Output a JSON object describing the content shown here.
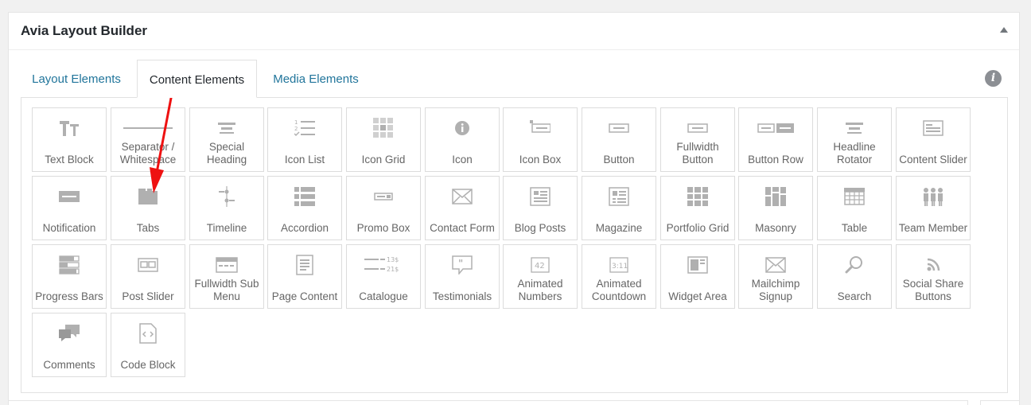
{
  "panel": {
    "title": "Avia Layout Builder"
  },
  "tabs": [
    {
      "label": "Layout Elements",
      "active": false
    },
    {
      "label": "Content Elements",
      "active": true
    },
    {
      "label": "Media Elements",
      "active": false
    }
  ],
  "elements": [
    {
      "label": "Text Block",
      "icon": "text-block-icon"
    },
    {
      "label": "Separator / Whitespace",
      "icon": "separator-icon"
    },
    {
      "label": "Special Heading",
      "icon": "special-heading-icon"
    },
    {
      "label": "Icon List",
      "icon": "icon-list-icon"
    },
    {
      "label": "Icon Grid",
      "icon": "icon-grid-icon"
    },
    {
      "label": "Icon",
      "icon": "info-circle-icon"
    },
    {
      "label": "Icon Box",
      "icon": "icon-box-icon"
    },
    {
      "label": "Button",
      "icon": "button-icon"
    },
    {
      "label": "Fullwidth Button",
      "icon": "fullwidth-button-icon"
    },
    {
      "label": "Button Row",
      "icon": "button-row-icon"
    },
    {
      "label": "Headline Rotator",
      "icon": "headline-rotator-icon"
    },
    {
      "label": "Content Slider",
      "icon": "content-slider-icon"
    },
    {
      "label": "Notification",
      "icon": "notification-icon"
    },
    {
      "label": "Tabs",
      "icon": "tabs-icon"
    },
    {
      "label": "Timeline",
      "icon": "timeline-icon"
    },
    {
      "label": "Accordion",
      "icon": "accordion-icon"
    },
    {
      "label": "Promo Box",
      "icon": "promo-box-icon"
    },
    {
      "label": "Contact Form",
      "icon": "envelope-icon"
    },
    {
      "label": "Blog Posts",
      "icon": "blog-posts-icon"
    },
    {
      "label": "Magazine",
      "icon": "magazine-icon"
    },
    {
      "label": "Portfolio Grid",
      "icon": "portfolio-grid-icon"
    },
    {
      "label": "Masonry",
      "icon": "masonry-icon"
    },
    {
      "label": "Table",
      "icon": "table-icon"
    },
    {
      "label": "Team Member",
      "icon": "team-member-icon"
    },
    {
      "label": "Progress Bars",
      "icon": "progress-bars-icon"
    },
    {
      "label": "Post Slider",
      "icon": "post-slider-icon"
    },
    {
      "label": "Fullwidth Sub Menu",
      "icon": "sub-menu-icon"
    },
    {
      "label": "Page Content",
      "icon": "page-content-icon"
    },
    {
      "label": "Catalogue",
      "icon": "catalogue-icon"
    },
    {
      "label": "Testimonials",
      "icon": "testimonials-icon"
    },
    {
      "label": "Animated Numbers",
      "icon": "animated-numbers-icon"
    },
    {
      "label": "Animated Countdown",
      "icon": "animated-countdown-icon"
    },
    {
      "label": "Widget Area",
      "icon": "widget-area-icon"
    },
    {
      "label": "Mailchimp Signup",
      "icon": "envelope-icon"
    },
    {
      "label": "Search",
      "icon": "search-icon"
    },
    {
      "label": "Social Share Buttons",
      "icon": "social-share-icon"
    },
    {
      "label": "Comments",
      "icon": "comments-icon"
    },
    {
      "label": "Code Block",
      "icon": "code-block-icon"
    }
  ],
  "colors": {
    "link": "#21759b",
    "icon": "#b0b0b0",
    "arrow": "#ee1111"
  }
}
